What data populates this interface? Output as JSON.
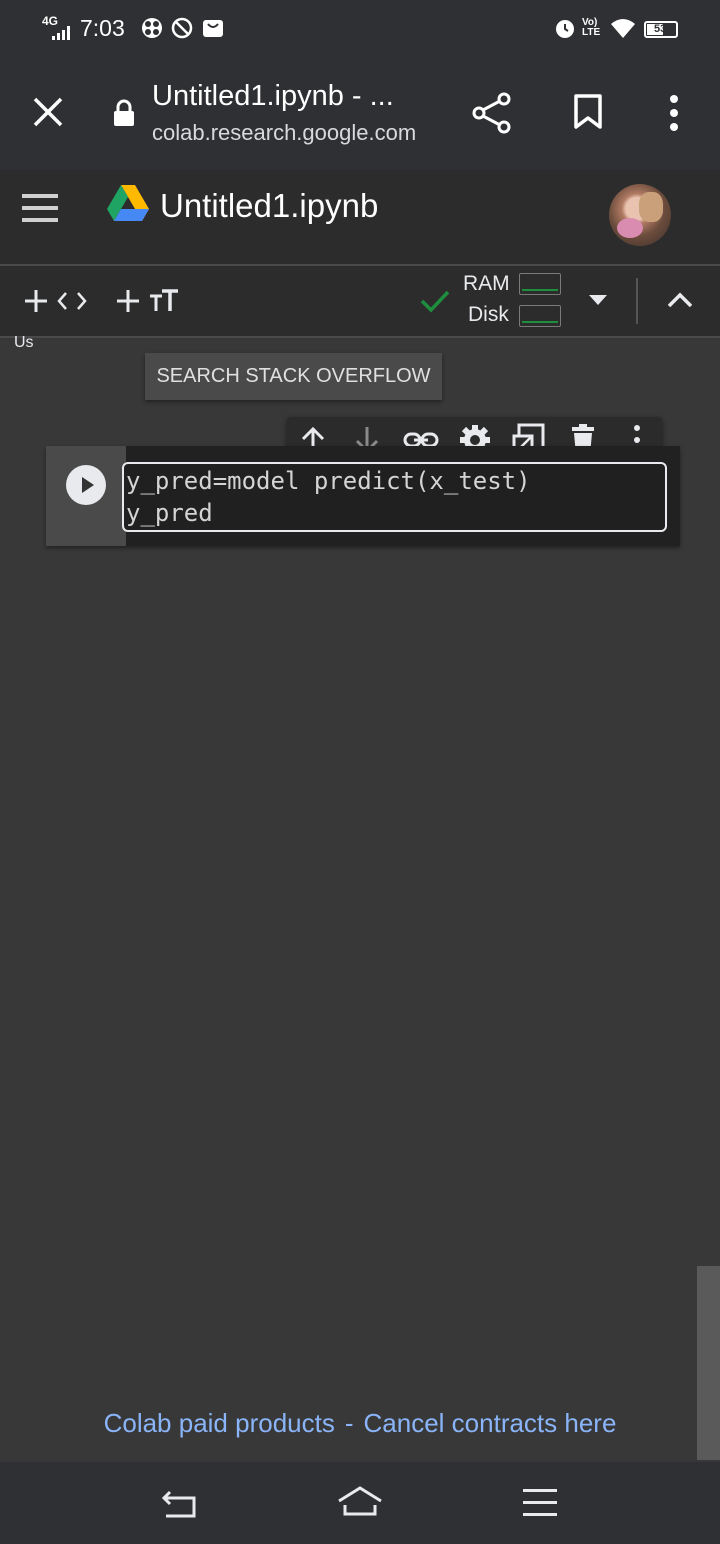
{
  "status_bar": {
    "network": "4G",
    "time": "7:03",
    "volte": "Vo) LTE",
    "battery": "53"
  },
  "browser": {
    "tab_title": "Untitled1.ipynb - ...",
    "url": "colab.research.google.com"
  },
  "colab": {
    "notebook_title": "Untitled1.ipynb",
    "ram_label": "RAM",
    "disk_label": "Disk",
    "tiny_label": "Us",
    "tooltip": "SEARCH STACK OVERFLOW"
  },
  "cell": {
    "code_lines": [
      "y_pred=model predict(x_test)",
      "y_pred"
    ]
  },
  "footer": {
    "left_link": "Colab paid products",
    "separator": "-",
    "right_link": "Cancel contracts here"
  },
  "colors": {
    "accent_green": "#1e8e3e",
    "link_blue": "#8ab4f8",
    "background": "#383838"
  }
}
